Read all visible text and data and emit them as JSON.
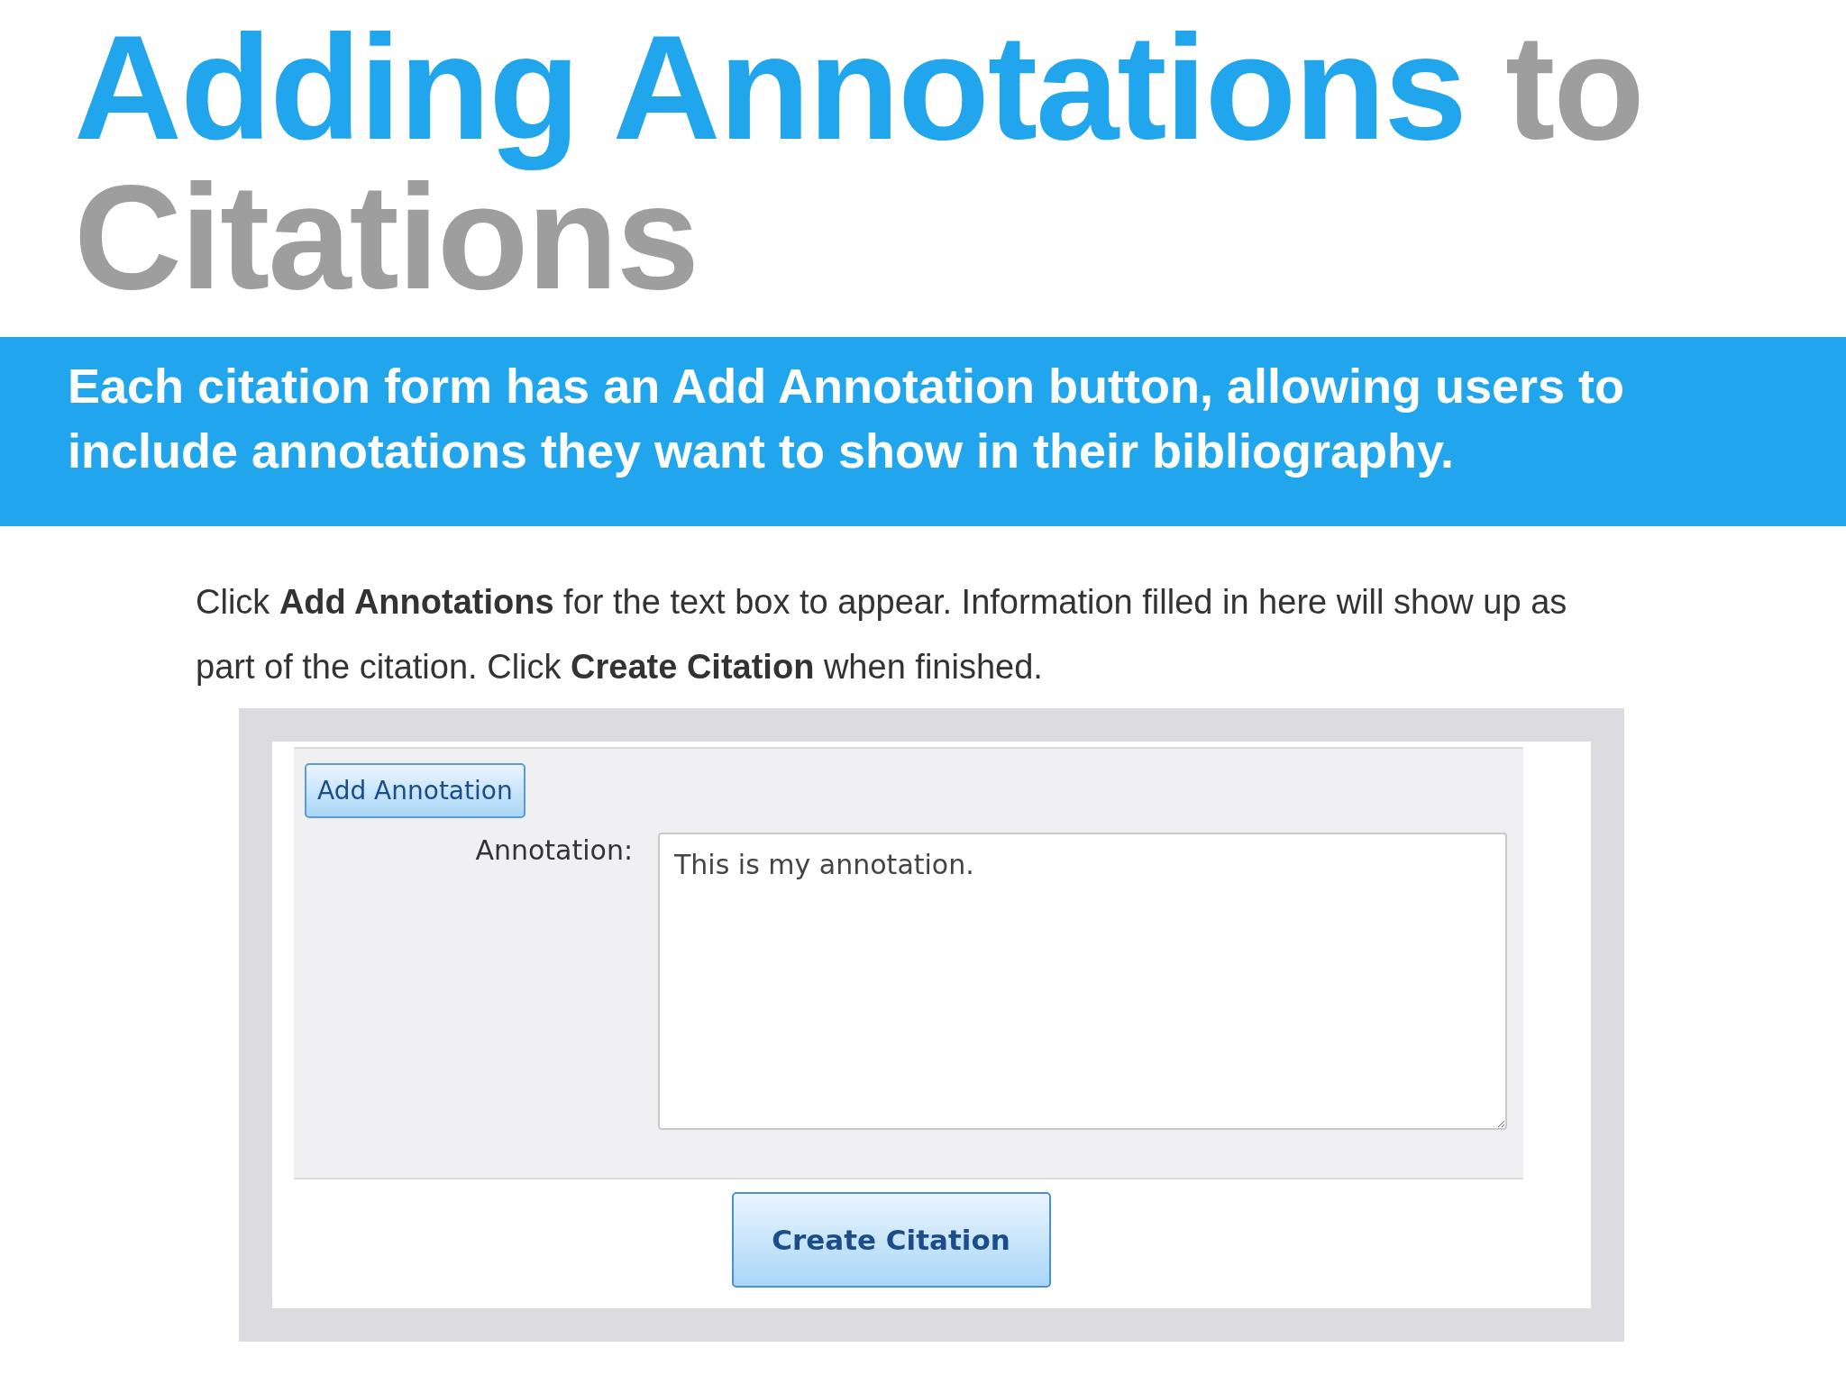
{
  "title": [
    {
      "text": "Adding Annotations",
      "kind": "accent"
    },
    {
      "text": "to Citations",
      "kind": "plain"
    }
  ],
  "banner": "Each citation form has an Add Annotation button, allowing users to include annotations they want to show in their bibliography.",
  "instructions": "Click **Add Annotations** for the text box to appear. Information filled in here will show up as part of the citation. Click **Create Citation** when finished.",
  "form": {
    "add_button": "Add Annotation",
    "field_label": "Annotation:",
    "field_value": "This is my annotation.",
    "submit_button": "Create Citation"
  }
}
